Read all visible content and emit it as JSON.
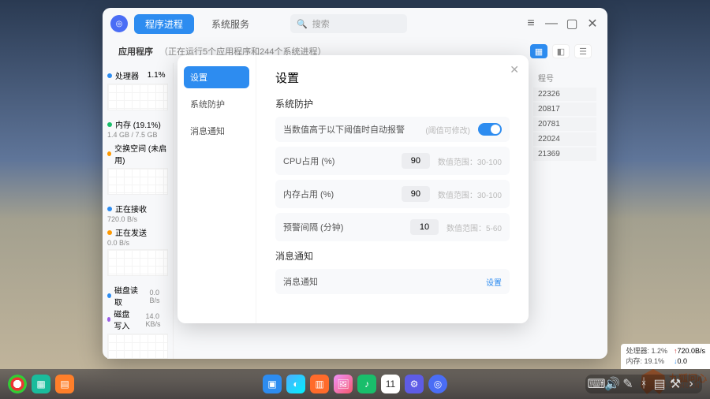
{
  "titlebar": {
    "tabs": [
      "程序进程",
      "系统服务"
    ],
    "search_placeholder": "搜索"
  },
  "subheader": {
    "title": "应用程序",
    "note": "（正在运行5个应用程序和244个系统进程）"
  },
  "sidebar_stats": [
    {
      "title": "处理器",
      "val": "1.1%",
      "color": "blue"
    },
    {
      "title": "内存 (19.1%)",
      "sub": "1.4 GB / 7.5 GB",
      "color": "green"
    },
    {
      "title": "交换空间 (未启用)",
      "color": "orange"
    },
    {
      "title": "正在接收",
      "sub": "720.0 B/s",
      "color": "blue"
    },
    {
      "title": "正在发送",
      "sub": "0.0 B/s",
      "color": "orange"
    },
    {
      "title": "磁盘读取",
      "sub": "0.0 B/s",
      "color": "blue",
      "inline": true
    },
    {
      "title": "磁盘写入",
      "sub": "14.0 KB/s",
      "color": "purple",
      "inline": true
    }
  ],
  "pid_column": {
    "header": "程号",
    "values": [
      "22326",
      "20817",
      "20781",
      "22024",
      "21369"
    ]
  },
  "modal": {
    "nav": [
      "设置",
      "系统防护",
      "消息通知"
    ],
    "title": "设置",
    "section1": "系统防护",
    "alarm_row": {
      "label": "当数值高于以下阈值时自动报警",
      "hint": "(阈值可修改)"
    },
    "rows": [
      {
        "label": "CPU占用 (%)",
        "value": "90",
        "range": "数值范围：30-100"
      },
      {
        "label": "内存占用 (%)",
        "value": "90",
        "range": "数值范围：30-100"
      },
      {
        "label": "预警间隔 (分钟)",
        "value": "10",
        "range": "数值范围：5-60"
      }
    ],
    "section2": "消息通知",
    "notify_row": {
      "label": "消息通知",
      "link": "设置"
    }
  },
  "statusbox": {
    "cpu": "处理器: 1.2%",
    "net_up": "720.0B/s",
    "mem": "内存: 19.1%",
    "net_dn": "0.0"
  },
  "watermark": {
    "t1": "九狐问心",
    "t2": "JIUHUCN"
  }
}
